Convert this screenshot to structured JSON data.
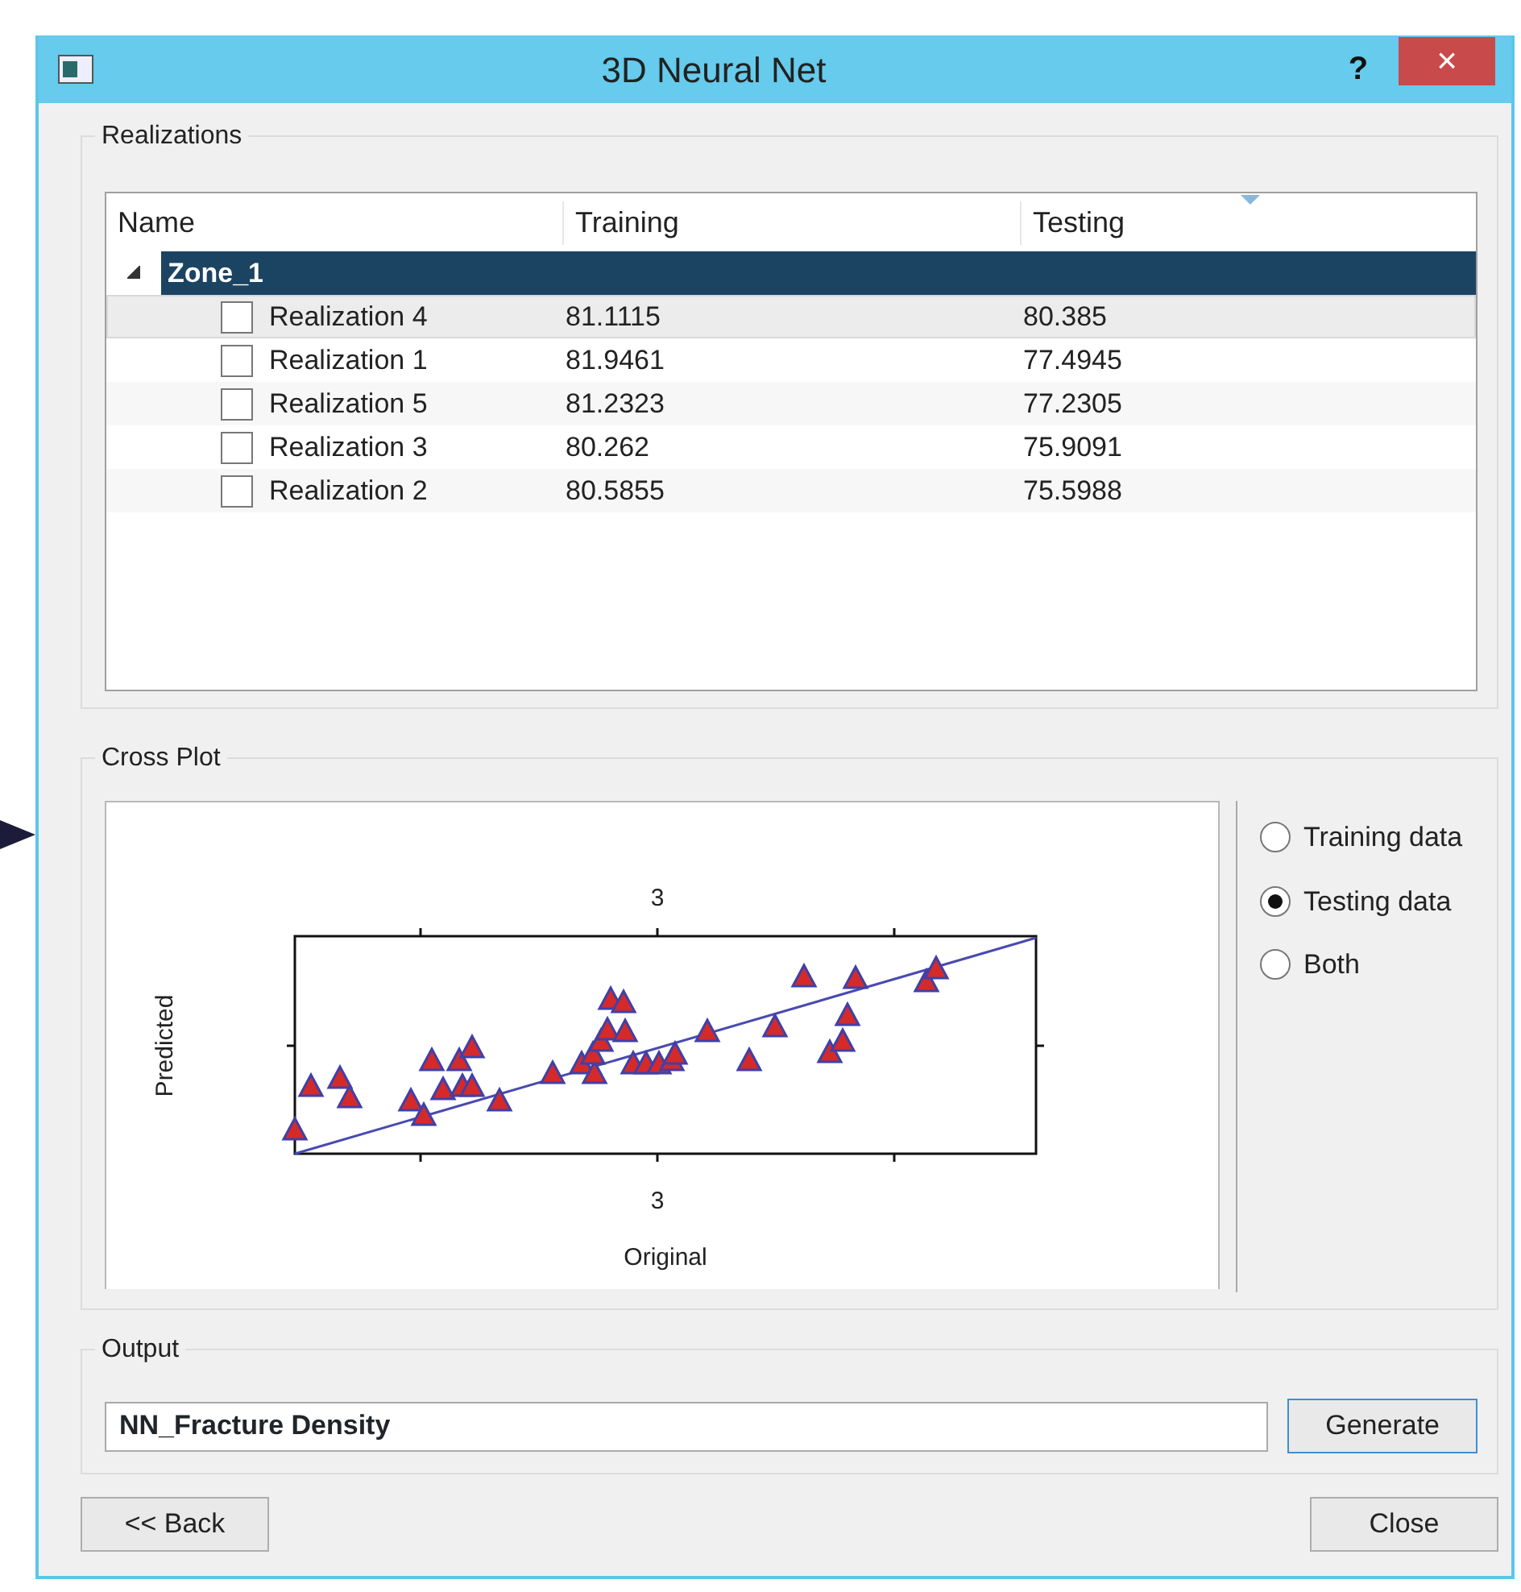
{
  "window": {
    "title": "3D Neural Net",
    "help": "?",
    "close": "×"
  },
  "realizations": {
    "title": "Realizations",
    "columns": [
      "Name",
      "Training",
      "Testing"
    ],
    "groups": [
      {
        "name": "Zone_1",
        "expanded": true,
        "selected": true,
        "children": [
          {
            "name": "Realization 4",
            "training": "81.1115",
            "testing": "80.385",
            "checked": false,
            "highlighted": true
          },
          {
            "name": "Realization 1",
            "training": "81.9461",
            "testing": "77.4945",
            "checked": false,
            "highlighted": false
          },
          {
            "name": "Realization 5",
            "training": "81.2323",
            "testing": "77.2305",
            "checked": false,
            "highlighted": false
          },
          {
            "name": "Realization 3",
            "training": "80.262",
            "testing": "75.9091",
            "checked": false,
            "highlighted": false
          },
          {
            "name": "Realization 2",
            "training": "80.5855",
            "testing": "75.5988",
            "checked": false,
            "highlighted": false
          }
        ]
      }
    ]
  },
  "cross_plot": {
    "title": "Cross Plot",
    "plot": {
      "top_tick": "3",
      "bottom_tick": "3",
      "ylabel": "Predicted",
      "xlabel": "Original"
    },
    "options": [
      {
        "label": "Training data",
        "selected": false
      },
      {
        "label": "Testing data",
        "selected": true
      },
      {
        "label": "Both",
        "selected": false
      }
    ]
  },
  "output": {
    "title": "Output",
    "value": "NN_Fracture Density",
    "button": "Generate"
  },
  "buttons": {
    "back": "<< Back",
    "close": "Close"
  }
}
